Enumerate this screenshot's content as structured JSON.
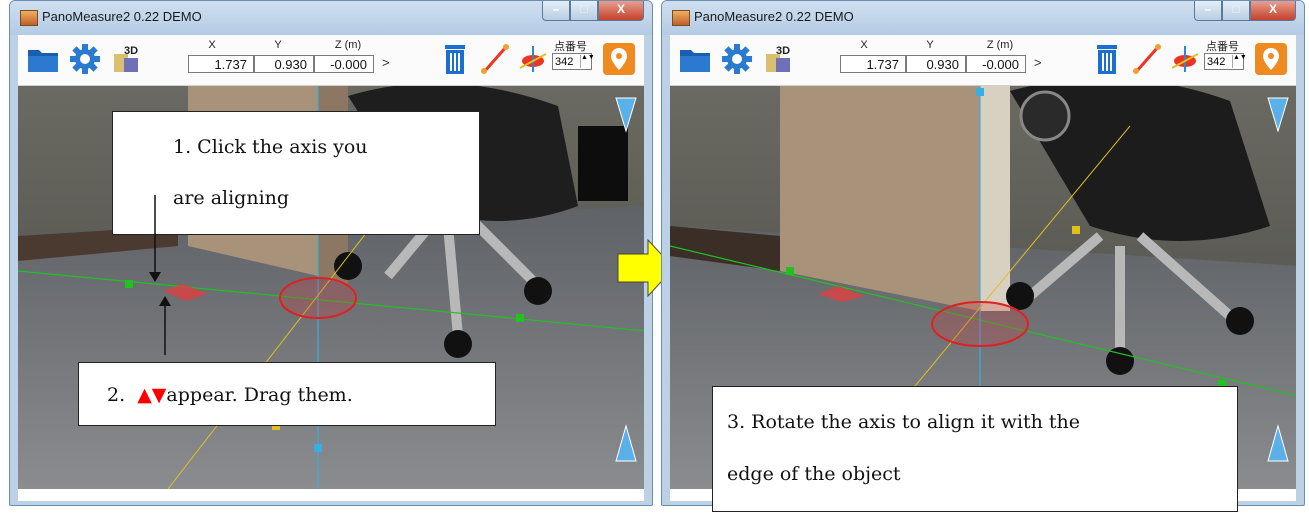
{
  "app": {
    "title": "PanoMeasure2 0.22 DEMO",
    "minimize_glyph": "–",
    "maximize_glyph": "□",
    "close_glyph": "X"
  },
  "toolbar": {
    "icons": [
      "open-folder-icon",
      "settings-gear-icon",
      "3d-view-icon",
      "trash-icon",
      "measure-line-icon",
      "axis-align-icon",
      "location-pin-icon"
    ],
    "three_d_text": "3D",
    "x_label": "X",
    "y_label": "Y",
    "z_label": "Z (m)",
    "x_value": "1.737",
    "y_value": "0.930",
    "z_value": "-0.000",
    "more": ">",
    "point_label": "点番号",
    "point_value": "342",
    "spinner_glyph": "▲▼"
  },
  "annotations": {
    "step1_line1": "1. Click the axis you",
    "step1_line2": "are aligning",
    "step2": "appear. Drag them.",
    "step2_prefix": "2.",
    "step2_triangles": "▲▼",
    "step3_line1": "3. Rotate the axis to align it with the",
    "step3_line2": "edge of the object"
  },
  "colors": {
    "accent_red": "#ff0000",
    "arrow_yellow": "#ffff00",
    "axis_green": "#22c022",
    "axis_cyan": "#3aaee0",
    "axis_yellow": "#e0c020",
    "ring_red": "#e02020"
  }
}
